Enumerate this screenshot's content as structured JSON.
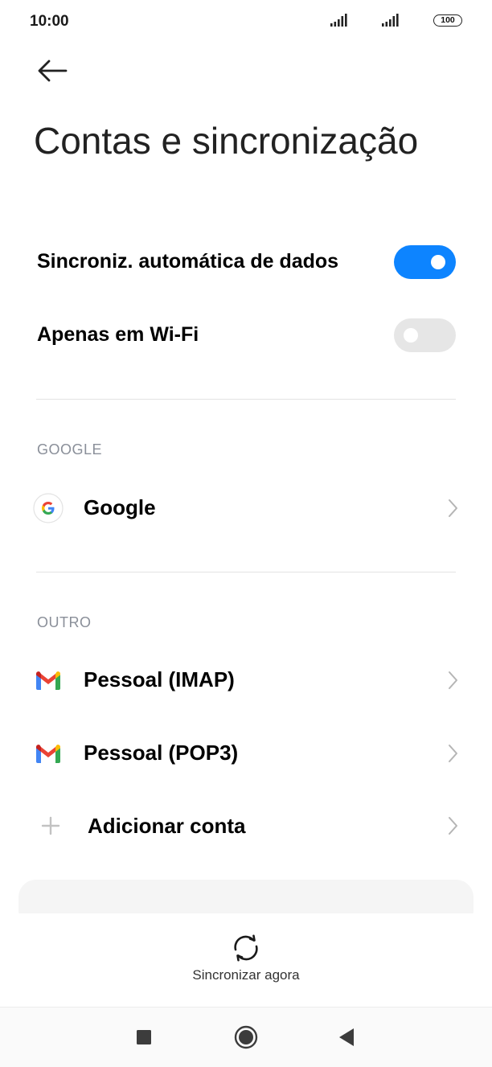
{
  "status_bar": {
    "time": "10:00",
    "battery": "100"
  },
  "header": {
    "title": "Contas e sincronização"
  },
  "settings": {
    "auto_sync": {
      "label": "Sincroniz. automática de dados",
      "enabled": true
    },
    "wifi_only": {
      "label": "Apenas em Wi-Fi",
      "enabled": false
    }
  },
  "sections": {
    "google": {
      "header": "GOOGLE",
      "accounts": [
        {
          "label": "Google",
          "icon": "google-icon"
        }
      ]
    },
    "other": {
      "header": "OUTRO",
      "accounts": [
        {
          "label": "Pessoal (IMAP)",
          "icon": "gmail-icon"
        },
        {
          "label": "Pessoal (POP3)",
          "icon": "gmail-icon"
        }
      ],
      "add_account": {
        "label": "Adicionar conta",
        "icon": "plus-icon"
      }
    }
  },
  "bottom_action": {
    "label": "Sincronizar agora",
    "icon": "sync-icon"
  },
  "nav": {
    "buttons": [
      "recents-icon",
      "home-icon",
      "back-triangle-icon"
    ]
  },
  "colors": {
    "accent": "#0d84ff",
    "toggle_off": "#e6e6e6",
    "section_header": "#8a8f99"
  }
}
